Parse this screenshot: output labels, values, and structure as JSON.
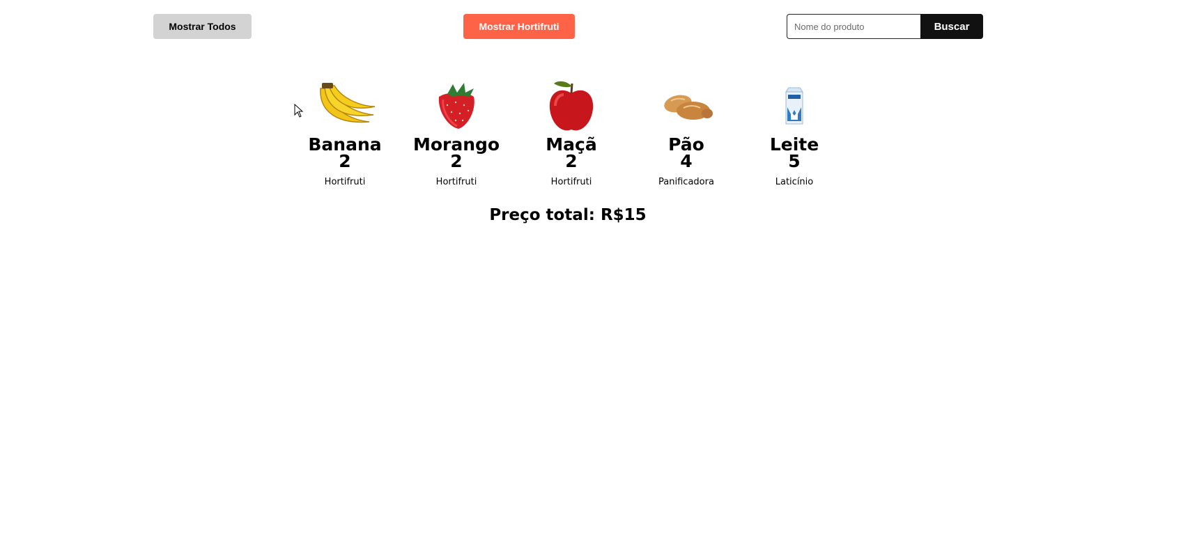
{
  "toolbar": {
    "show_all_label": "Mostrar Todos",
    "show_hortifruti_label": "Mostrar Hortifruti",
    "search_placeholder": "Nome do produto",
    "search_value": "",
    "search_button_label": "Buscar"
  },
  "colors": {
    "show_all_bg": "#d3d3d3",
    "hortifruti_bg": "#ff6347",
    "search_button_bg": "#111111"
  },
  "products": [
    {
      "name": "Banana",
      "quantity": "2",
      "category": "Hortifruti",
      "icon": "banana-icon"
    },
    {
      "name": "Morango",
      "quantity": "2",
      "category": "Hortifruti",
      "icon": "strawberry-icon"
    },
    {
      "name": "Maçã",
      "quantity": "2",
      "category": "Hortifruti",
      "icon": "apple-icon"
    },
    {
      "name": "Pão",
      "quantity": "4",
      "category": "Panificadora",
      "icon": "bread-icon"
    },
    {
      "name": "Leite",
      "quantity": "5",
      "category": "Laticínio",
      "icon": "milk-carton-icon"
    }
  ],
  "summary": {
    "total_label": "Preço total: R$15"
  }
}
